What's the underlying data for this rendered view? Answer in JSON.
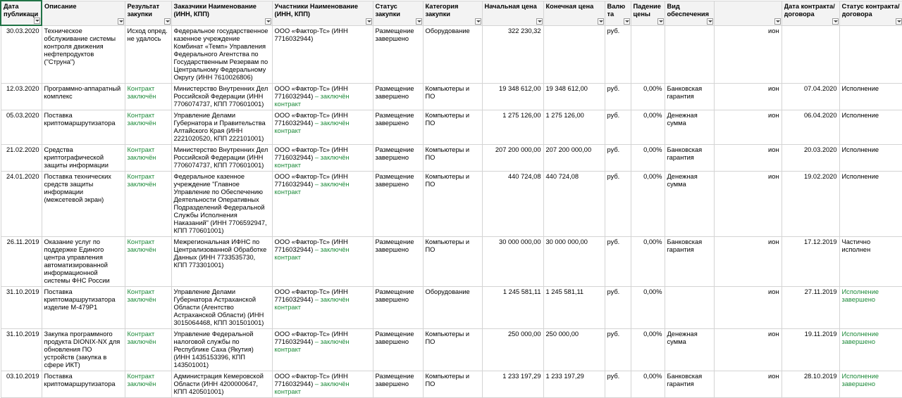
{
  "columns": [
    {
      "label": "Дата публикации"
    },
    {
      "label": "Описание"
    },
    {
      "label": "Результат закупки"
    },
    {
      "label": "Заказчики Наименование (ИНН, КПП)"
    },
    {
      "label": "Участники Наименование (ИНН, КПП)"
    },
    {
      "label": "Статус закупки"
    },
    {
      "label": "Категория закупки"
    },
    {
      "label": "Начальная цена"
    },
    {
      "label": "Конечная цена"
    },
    {
      "label": "Валюта"
    },
    {
      "label": "Падение цены"
    },
    {
      "label": "Вид обеспечения"
    },
    {
      "label": ""
    },
    {
      "label": "Дата контракта/договора"
    },
    {
      "label": "Статус контракта/договора"
    }
  ],
  "rows": [
    {
      "date": "30.03.2020",
      "desc": "Техническое обслуживание системы контроля движения нефтепродуктов (\"Струна\")",
      "result": "Исход опред. не удалось",
      "result_green": false,
      "customer": "Федеральное государственное казенное учреждение Комбинат «Темп» Управления Федерального Агентства по Государственным Резервам по Центральному Федеральному Округу (ИНН 7610026806)",
      "participant": "ООО «Фактор-Тс» (ИНН 7716032944)",
      "participant_note": "",
      "status": "Размещение завершено",
      "category": "Оборудование",
      "start_price": "322 230,32",
      "end_price": "",
      "currency": "руб.",
      "drop": "",
      "security": "",
      "extra": "ион",
      "contract_date": "",
      "contract_status": "",
      "cs_green": false
    },
    {
      "date": "12.03.2020",
      "desc": "Программно-аппаратный комплекс",
      "result": "Контракт заключён",
      "result_green": true,
      "customer": "Министерство Внутренних Дел Российской Федерации (ИНН 7706074737, КПП 770601001)",
      "participant": "ООО «Фактор-Тс» (ИНН 7716032944)",
      "participant_note": " – заключён контракт",
      "status": "Размещение завершено",
      "category": "Компьютеры и ПО",
      "start_price": "19 348 612,00",
      "end_price": "19 348 612,00",
      "currency": "руб.",
      "drop": "0,00%",
      "security": "Банковская гарантия",
      "extra": "ион",
      "contract_date": "07.04.2020",
      "contract_status": "Исполнение",
      "cs_green": false
    },
    {
      "date": "05.03.2020",
      "desc": "Поставка криптомаршрутизатора",
      "result": "Контракт заключён",
      "result_green": true,
      "customer": "Управление Делами Губернатора и Правительства Алтайского Края (ИНН 2221020520, КПП 222101001)",
      "participant": "ООО «Фактор-Тс» (ИНН 7716032944)",
      "participant_note": " – заключён контракт",
      "status": "Размещение завершено",
      "category": "Компьютеры и ПО",
      "start_price": "1 275 126,00",
      "end_price": "1 275 126,00",
      "currency": "руб.",
      "drop": "0,00%",
      "security": "Денежная сумма",
      "extra": "ион",
      "contract_date": "06.04.2020",
      "contract_status": "Исполнение",
      "cs_green": false
    },
    {
      "date": "21.02.2020",
      "desc": "Средства криптографической защиты информации",
      "result": "Контракт заключён",
      "result_green": true,
      "customer": "Министерство Внутренних Дел Российской Федерации (ИНН 7706074737, КПП 770601001)",
      "participant": "ООО «Фактор-Тс» (ИНН 7716032944)",
      "participant_note": " – заключён контракт",
      "status": "Размещение завершено",
      "category": "Компьютеры и ПО",
      "start_price": "207 200 000,00",
      "end_price": "207 200 000,00",
      "currency": "руб.",
      "drop": "0,00%",
      "security": "Банковская гарантия",
      "extra": "ион",
      "contract_date": "20.03.2020",
      "contract_status": "Исполнение",
      "cs_green": false
    },
    {
      "date": "24.01.2020",
      "desc": "Поставка технических средств защиты информации (межсетевой экран)",
      "result": "Контракт заключён",
      "result_green": true,
      "customer": "Федеральное казенное учреждение \"Главное Управление по Обеспечению Деятельности Оперативных Подразделений Федеральной Службы Исполнения Наказаний\" (ИНН 7706592947, КПП 770601001)",
      "participant": "ООО «Фактор-Тс» (ИНН 7716032944)",
      "participant_note": " – заключён контракт",
      "status": "Размещение завершено",
      "category": "Компьютеры и ПО",
      "start_price": "440 724,08",
      "end_price": "440 724,08",
      "currency": "руб.",
      "drop": "0,00%",
      "security": "Денежная сумма",
      "extra": "ион",
      "contract_date": "19.02.2020",
      "contract_status": "Исполнение",
      "cs_green": false
    },
    {
      "date": "26.11.2019",
      "desc": "Оказание услуг по поддержке Единого центра управления автоматизированной информационной системы ФНС России",
      "result": "Контракт заключён",
      "result_green": true,
      "customer": "Межрегиональная ИФНС по Централизованной Обработке Данных (ИНН 7733535730, КПП 773301001)",
      "participant": "ООО «Фактор-Тс» (ИНН 7716032944)",
      "participant_note": " – заключён контракт",
      "status": "Размещение завершено",
      "category": "Компьютеры и ПО",
      "start_price": "30 000 000,00",
      "end_price": "30 000 000,00",
      "currency": "руб.",
      "drop": "0,00%",
      "security": "Банковская гарантия",
      "extra": "ион",
      "contract_date": "17.12.2019",
      "contract_status": "Частично исполнен",
      "cs_green": false
    },
    {
      "date": "31.10.2019",
      "desc": "Поставка криптомаршрутизатора изделие М-479Р1",
      "result": "Контракт заключён",
      "result_green": true,
      "customer": "Управление Делами Губернатора Астраханской Области (Агентство Астраханской Области) (ИНН 3015064468, КПП 301501001)",
      "participant": "ООО «Фактор-Тс» (ИНН 7716032944)",
      "participant_note": " – заключён контракт",
      "status": "Размещение завершено",
      "category": "Оборудование",
      "start_price": "1 245 581,11",
      "end_price": "1 245 581,11",
      "currency": "руб.",
      "drop": "0,00%",
      "security": "",
      "extra": "ион",
      "contract_date": "27.11.2019",
      "contract_status": "Исполнение завершено",
      "cs_green": true
    },
    {
      "date": "31.10.2019",
      "desc": "Закупка программного продукта DIONIX-NX для обновления ПО устройств (закупка в сфере ИКТ)",
      "result": "Контракт заключён",
      "result_green": true,
      "customer": "Управление Федеральной налоговой службы по Республике Саха (Якутия) (ИНН 1435153396, КПП 143501001)",
      "participant": "ООО «Фактор-Тс» (ИНН 7716032944)",
      "participant_note": " – заключён контракт",
      "status": "Размещение завершено",
      "category": "Компьютеры и ПО",
      "start_price": "250 000,00",
      "end_price": "250 000,00",
      "currency": "руб.",
      "drop": "0,00%",
      "security": "Денежная сумма",
      "extra": "ион",
      "contract_date": "19.11.2019",
      "contract_status": "Исполнение завершено",
      "cs_green": true
    },
    {
      "date": "03.10.2019",
      "desc": "Поставка криптомаршрутизатора",
      "result": "Контракт заключён",
      "result_green": true,
      "customer": "Администрация Кемеровской Области (ИНН 4200000647, КПП 420501001)",
      "participant": "ООО «Фактор-Тс» (ИНН 7716032944)",
      "participant_note": " – заключён контракт",
      "status": "Размещение завершено",
      "category": "Компьютеры и ПО",
      "start_price": "1 233 197,29",
      "end_price": "1 233 197,29",
      "currency": "руб.",
      "drop": "0,00%",
      "security": "Банковская гарантия",
      "extra": "ион",
      "contract_date": "28.10.2019",
      "contract_status": "Исполнение завершено",
      "cs_green": true
    }
  ]
}
